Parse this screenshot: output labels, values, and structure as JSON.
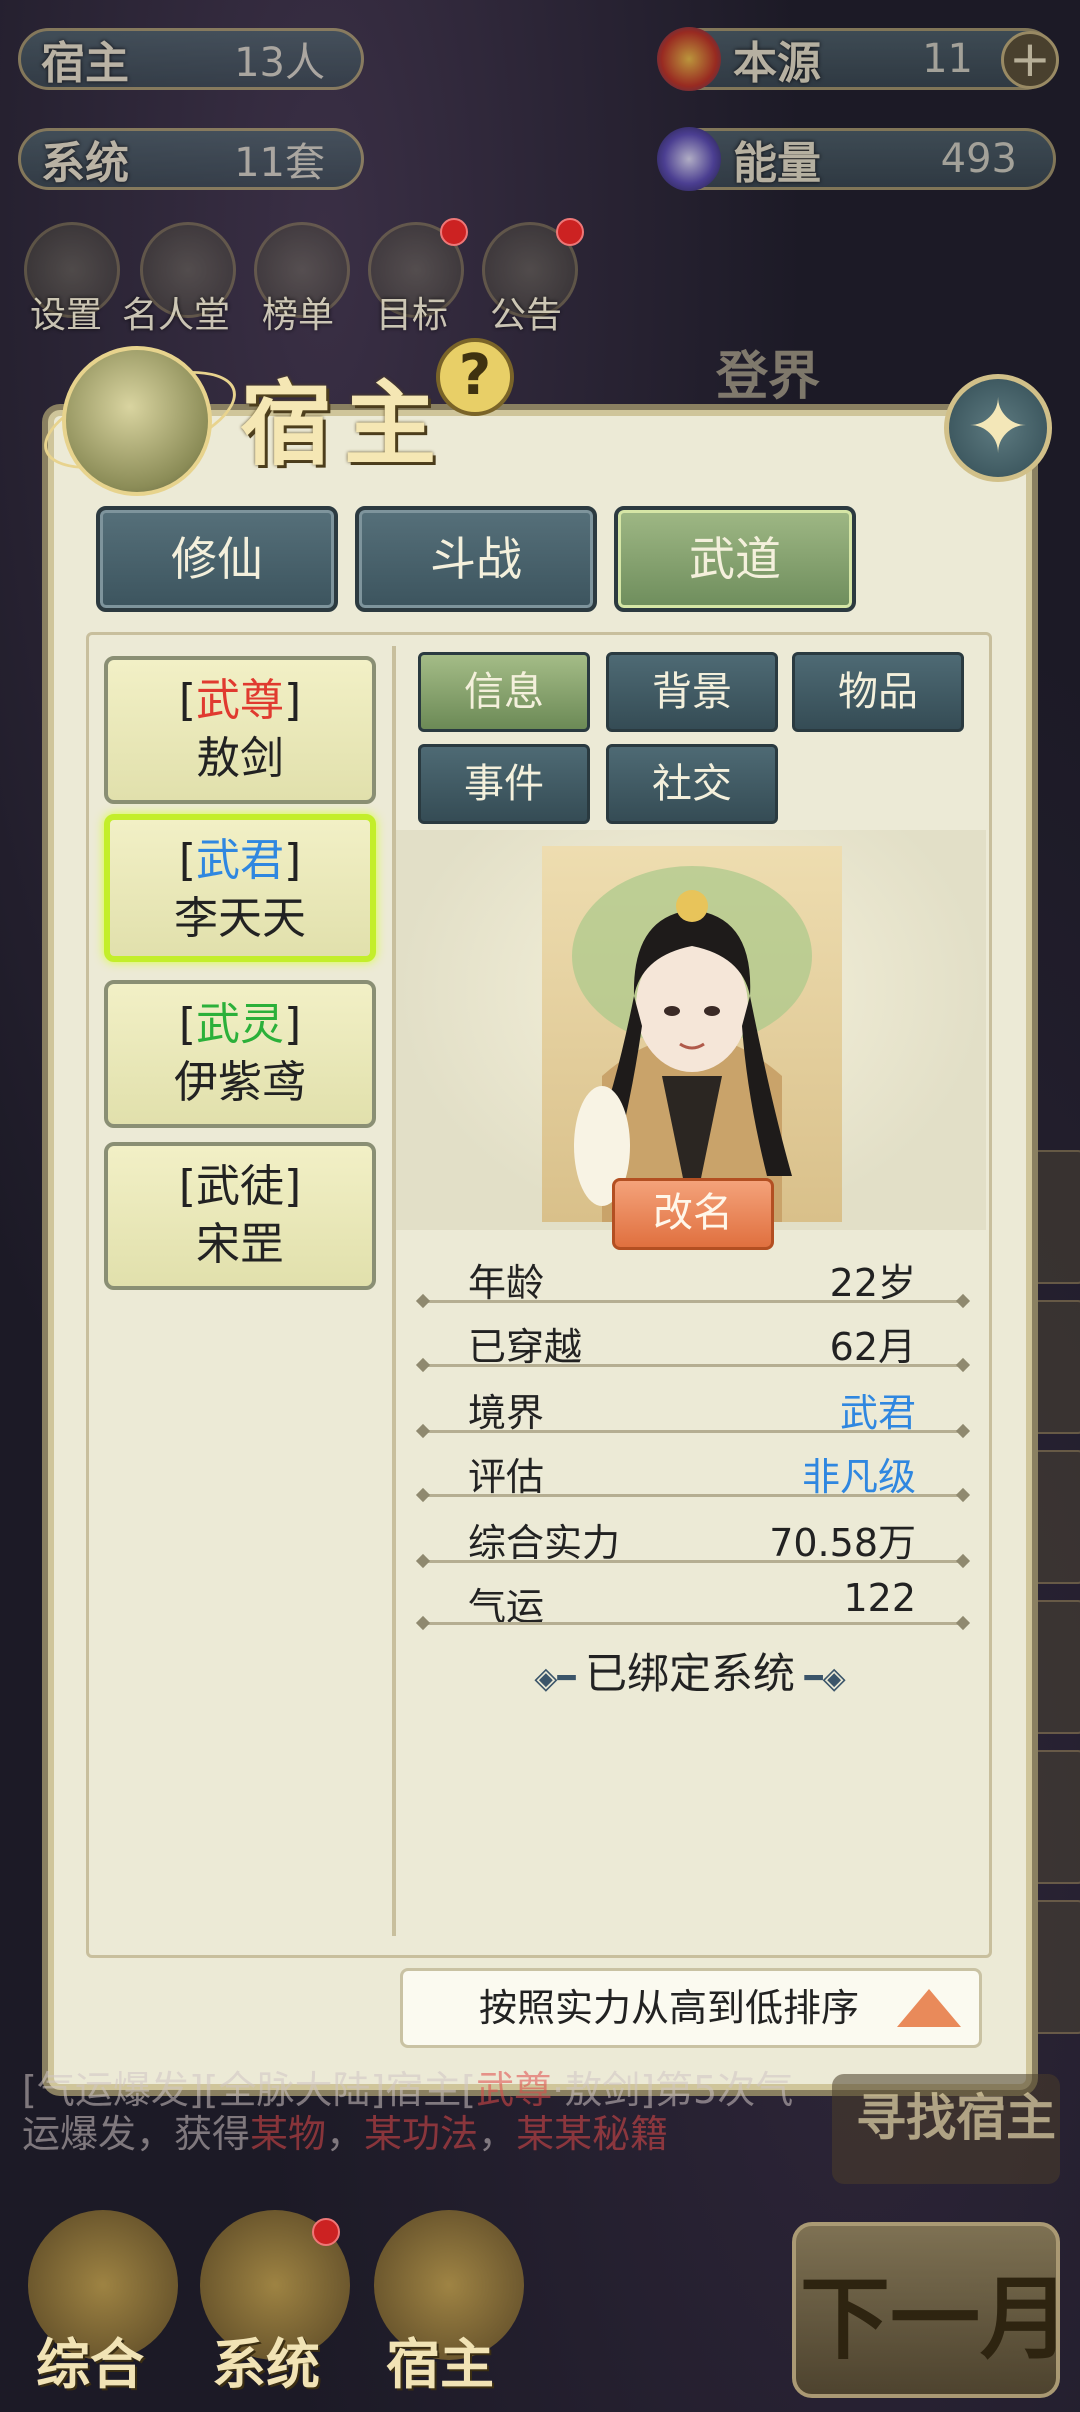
{
  "top_bar": {
    "hosts": {
      "label": "宿主",
      "value": "13人"
    },
    "origin": {
      "label": "本源",
      "value": "11",
      "plus": "+"
    },
    "systems": {
      "label": "系统",
      "value": "11套"
    },
    "energy": {
      "label": "能量",
      "value": "493"
    }
  },
  "top_menu": {
    "items": [
      {
        "label": "设置",
        "icon": "gear-icon",
        "badge": false
      },
      {
        "label": "名人堂",
        "icon": "hall-of-fame-icon",
        "badge": false
      },
      {
        "label": "榜单",
        "icon": "leaderboard-icon",
        "badge": false
      },
      {
        "label": "目标",
        "icon": "target-icon",
        "badge": true
      },
      {
        "label": "公告",
        "icon": "announcement-icon",
        "badge": true
      }
    ],
    "side_label": "登界"
  },
  "panel": {
    "title": "宿主",
    "help": "?",
    "categories": [
      {
        "label": "修仙",
        "active": false
      },
      {
        "label": "斗战",
        "active": false
      },
      {
        "label": "武道",
        "active": true
      }
    ],
    "hosts": [
      {
        "rank": "武尊",
        "name": "敖剑",
        "rank_color": "#e03a2f",
        "selected": false
      },
      {
        "rank": "武君",
        "name": "李天天",
        "rank_color": "#2f87e0",
        "selected": true
      },
      {
        "rank": "武灵",
        "name": "伊紫鸢",
        "rank_color": "#2bb03a",
        "selected": false
      },
      {
        "rank": "武徒",
        "name": "宋罡",
        "rank_color": "#222222",
        "selected": false
      }
    ],
    "info_tabs": [
      {
        "label": "信息",
        "active": true
      },
      {
        "label": "背景",
        "active": false
      },
      {
        "label": "物品",
        "active": false
      },
      {
        "label": "事件",
        "active": false
      },
      {
        "label": "社交",
        "active": false
      }
    ],
    "rename_label": "改名",
    "stats": [
      {
        "key": "年龄",
        "value": "22岁",
        "highlight": false
      },
      {
        "key": "已穿越",
        "value": "62月",
        "highlight": false
      },
      {
        "key": "境界",
        "value": "武君",
        "highlight": true
      },
      {
        "key": "评估",
        "value": "非凡级",
        "highlight": true
      },
      {
        "key": "综合实力",
        "value": "70.58万",
        "highlight": false
      },
      {
        "key": "气运",
        "value": "122",
        "highlight": false
      }
    ],
    "bound_system": "已绑定系统",
    "sort_label": "按照实力从高到低排序"
  },
  "log": {
    "line1_a": "[气运爆发][全脉大陆]宿主[",
    "line1_rank": "武尊",
    "line1_b": "·敖剑]第5次气",
    "line2": "运爆发，获得",
    "items": [
      "某物",
      "某功法",
      "某某秘籍"
    ]
  },
  "bottom_nav": {
    "items": [
      {
        "label": "综合",
        "badge": false
      },
      {
        "label": "系统",
        "badge": true
      },
      {
        "label": "宿主",
        "badge": false
      }
    ],
    "find_host": "寻找宿主",
    "next_month": "下一月"
  },
  "colors": {
    "accent_gold": "#cfc59a",
    "tab_teal": "#4e6a74",
    "tab_active_green": "#8aa56f",
    "selected_glow": "#c3ee2a",
    "rank_blue": "#2f87e0"
  }
}
